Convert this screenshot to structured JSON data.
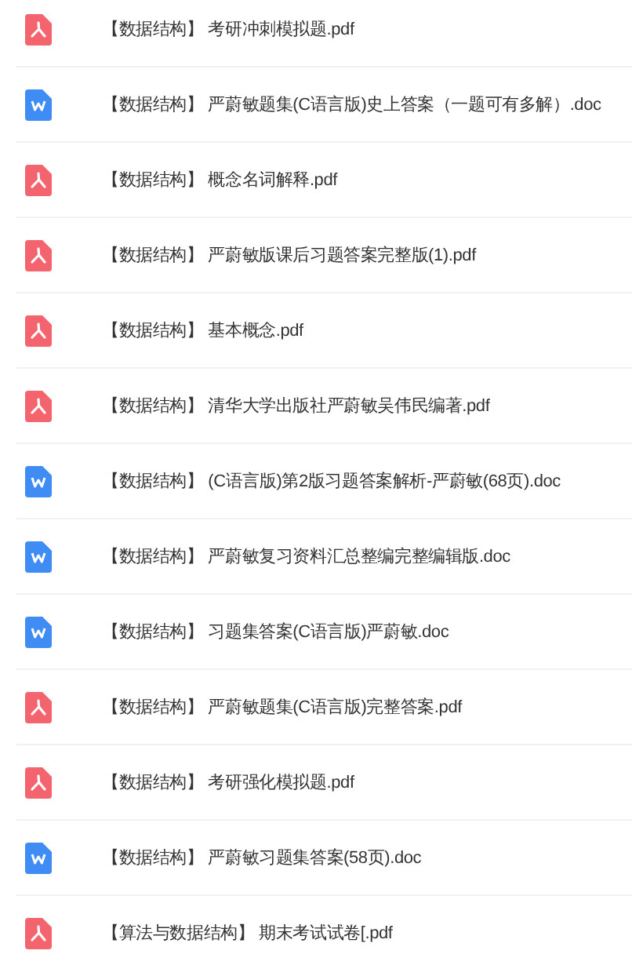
{
  "files": [
    {
      "kind": "pdf",
      "name": "【数据结构】 考研冲刺模拟题.pdf"
    },
    {
      "kind": "doc",
      "name": "【数据结构】 严蔚敏题集(C语言版)史上答案（一题可有多解）.doc"
    },
    {
      "kind": "pdf",
      "name": "【数据结构】 概念名词解释.pdf"
    },
    {
      "kind": "pdf",
      "name": "【数据结构】 严蔚敏版课后习题答案完整版(1).pdf"
    },
    {
      "kind": "pdf",
      "name": "【数据结构】 基本概念.pdf"
    },
    {
      "kind": "pdf",
      "name": "【数据结构】 清华大学出版社严蔚敏吴伟民编著.pdf"
    },
    {
      "kind": "doc",
      "name": "【数据结构】 (C语言版)第2版习题答案解析-严蔚敏(68页).doc"
    },
    {
      "kind": "doc",
      "name": "【数据结构】 严蔚敏复习资料汇总整编完整编辑版.doc"
    },
    {
      "kind": "doc",
      "name": "【数据结构】 习题集答案(C语言版)严蔚敏.doc"
    },
    {
      "kind": "pdf",
      "name": "【数据结构】 严蔚敏题集(C语言版)完整答案.pdf"
    },
    {
      "kind": "pdf",
      "name": "【数据结构】 考研强化模拟题.pdf"
    },
    {
      "kind": "doc",
      "name": "【数据结构】 严蔚敏习题集答案(58页).doc"
    },
    {
      "kind": "pdf",
      "name": "【算法与数据结构】 期末考试试卷[.pdf"
    }
  ]
}
